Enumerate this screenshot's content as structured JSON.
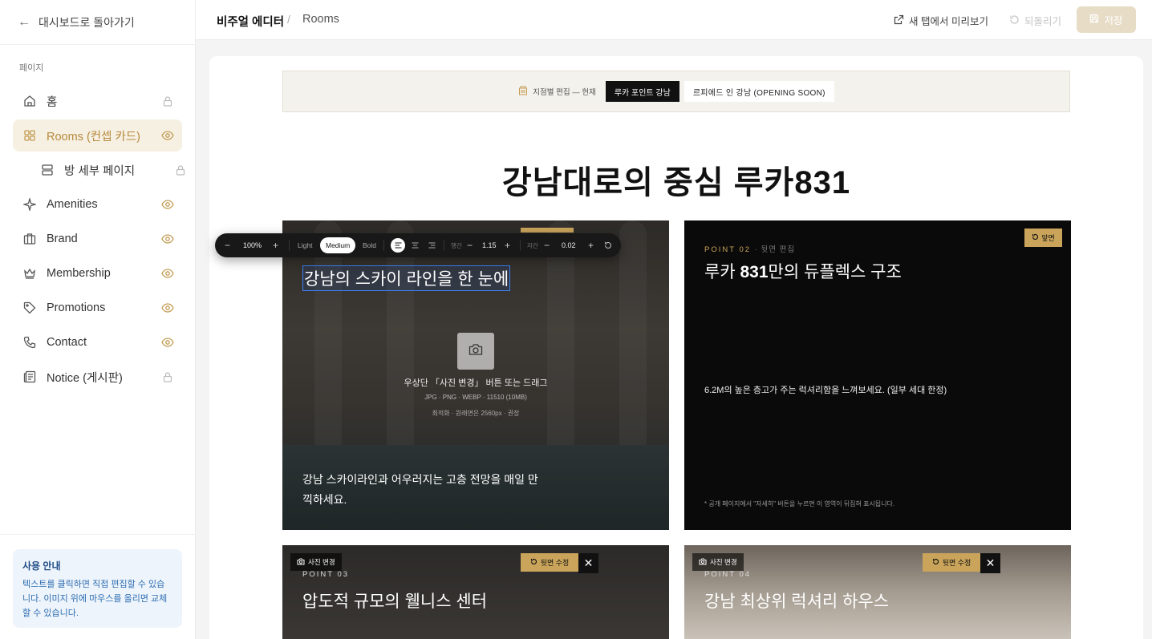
{
  "sidebar": {
    "back_label": "대시보드로 돌아가기",
    "section_label": "페이지",
    "items": [
      {
        "label": "홈",
        "icon": "home-icon",
        "status": "lock-icon"
      },
      {
        "label": "Rooms (컨셉 카드)",
        "icon": "grid-icon",
        "status": "eye-icon",
        "active": true
      },
      {
        "label": "방 세부 페이지",
        "icon": "layout-icon",
        "status": "lock-icon",
        "sub": true
      },
      {
        "label": "Amenities",
        "icon": "sparkle-icon",
        "status": "eye-icon"
      },
      {
        "label": "Brand",
        "icon": "briefcase-icon",
        "status": "eye-icon"
      },
      {
        "label": "Membership",
        "icon": "crown-icon",
        "status": "eye-icon"
      },
      {
        "label": "Promotions",
        "icon": "tag-icon",
        "status": "eye-icon"
      },
      {
        "label": "Contact",
        "icon": "phone-icon",
        "status": "eye-icon"
      },
      {
        "label": "Notice (게시판)",
        "icon": "newspaper-icon",
        "status": "lock-icon"
      }
    ],
    "guide": {
      "title": "사용 안내",
      "text": "텍스트를 클릭하면 직접 편집할 수 있습니다. 이미지 위에 마우스를 올리면 교체할 수 있습니다."
    }
  },
  "topbar": {
    "app_title": "비주얼 에디터",
    "separator": "/",
    "page_title": "Rooms",
    "preview_label": "새 탭에서 미리보기",
    "undo_label": "되돌리기",
    "save_label": "저장"
  },
  "branch": {
    "label": "지점별 편집 — 현재",
    "tabs": [
      {
        "label": "루카 포인트 강남",
        "active": true
      },
      {
        "label": "르피에드 인 강남 (OPENING SOON)",
        "active": false
      }
    ]
  },
  "headline": {
    "main": "강남대로의 중심 루카",
    "bold": "831"
  },
  "toolbar": {
    "zoom_minus": "−",
    "zoom": "100%",
    "zoom_plus": "+",
    "weight_light": "Light",
    "weight_medium": "Medium",
    "weight_bold": "Bold",
    "line_label": "행간",
    "line_minus": "−",
    "line_height": "1.15",
    "line_plus": "+",
    "letter_label": "자간",
    "letter_minus": "−",
    "letter_spacing": "0.02",
    "letter_plus": "+"
  },
  "cards": {
    "card1": {
      "title": "강남의 스카이 라인을 한 눈에",
      "upload_line1": "우상단 「사진 변경」 버튼 또는 드래그",
      "upload_line2": "JPG · PNG · WEBP · 11510 (10MB)",
      "upload_line3": "최적화 · 원래면은 2560px · 권장",
      "desc": "강남 스카이라인과 어우러지는 고층 전망을 매일 만끽하세요."
    },
    "card2": {
      "point": "POINT 02",
      "point_sub": "· 뒷면 편집",
      "title_prefix": "루카 ",
      "title_bold": "831",
      "title_suffix": "만의 듀플렉스 구조",
      "desc": "6.2M의 높은 층고가 주는 럭셔리함을 느껴보세요. (일부 세대 한정)",
      "note": "* 공개 페이지에서 \"자세히\" 버튼을 누르면 이 영역이 뒤집혀 표시됩니다.",
      "front_label": "앞면"
    },
    "card3": {
      "photo_label": "사진 변경",
      "point": "POINT 03",
      "title": "압도적 규모의 웰니스 센터",
      "back_label": "뒷면 수정",
      "close": "✕"
    },
    "card4": {
      "photo_label": "사진 변경",
      "point": "POINT 04",
      "title": "강남 최상위 럭셔리 하우스",
      "back_label": "뒷면 수정",
      "close": "✕"
    }
  },
  "colors": {
    "accent": "#c9a45a",
    "active_bg": "#f6f0e3",
    "save_bg": "#e7dcc6",
    "guide_bg": "#eef4fb"
  }
}
